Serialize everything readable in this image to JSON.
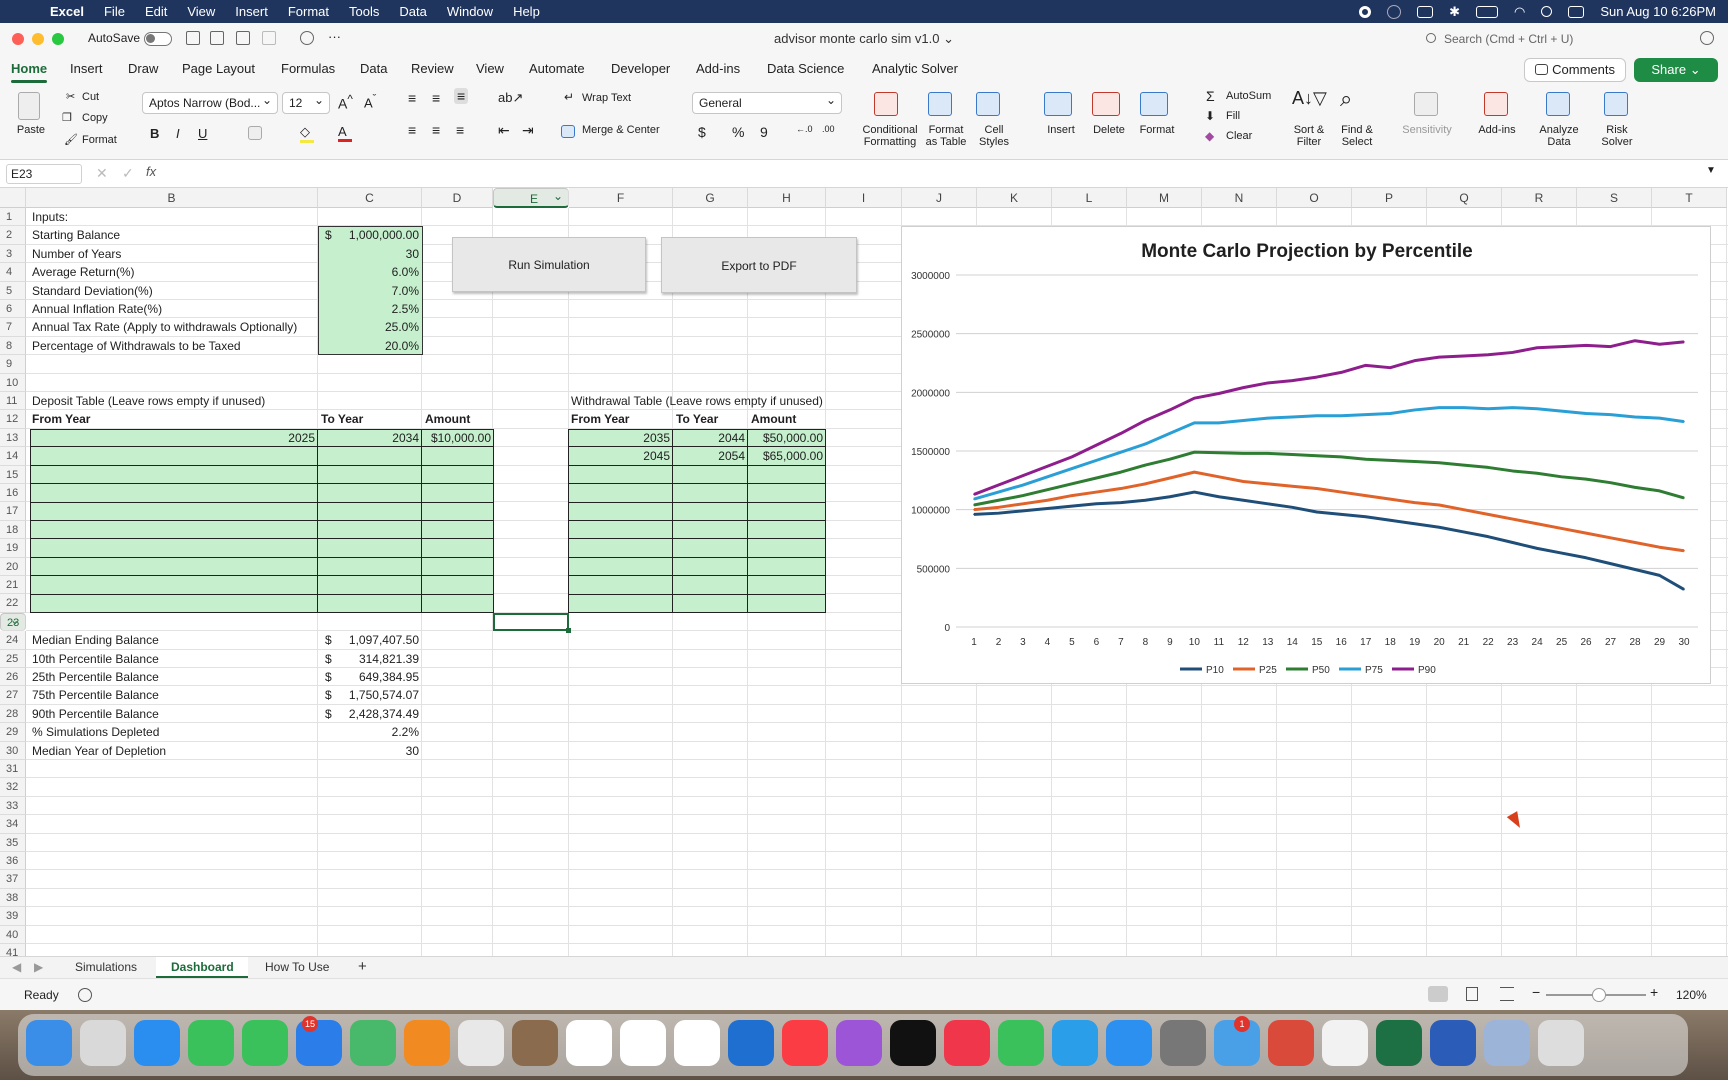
{
  "menubar": {
    "app": "Excel",
    "items": [
      "File",
      "Edit",
      "View",
      "Insert",
      "Format",
      "Tools",
      "Data",
      "Window",
      "Help"
    ],
    "clock": "Sun Aug 10  6:26PM"
  },
  "titlebar": {
    "autosave": "AutoSave",
    "doc_title": "advisor monte carlo sim v1.0",
    "search_placeholder": "Search (Cmd + Ctrl + U)"
  },
  "ribbon_tabs": [
    "Home",
    "Insert",
    "Draw",
    "Page Layout",
    "Formulas",
    "Data",
    "Review",
    "View",
    "Automate",
    "Developer",
    "Add-ins",
    "Data Science",
    "Analytic Solver"
  ],
  "comments": "Comments",
  "share": "Share",
  "ribbon": {
    "paste": "Paste",
    "cut": "Cut",
    "copy": "Copy",
    "format_painter": "Format",
    "font_name": "Aptos Narrow (Bod...",
    "font_size": "12",
    "bold": "B",
    "italic": "I",
    "underline": "U",
    "wrap_text": "Wrap Text",
    "merge_center": "Merge & Center",
    "number_format": "General",
    "dollar": "$",
    "percent": "%",
    "comma": "9",
    "conditional": "Conditional\nFormatting",
    "format_table": "Format\nas Table",
    "cell_styles": "Cell\nStyles",
    "insert": "Insert",
    "delete": "Delete",
    "format": "Format",
    "autosum": "AutoSum",
    "fill": "Fill",
    "clear": "Clear",
    "sort_filter": "Sort &\nFilter",
    "find_select": "Find &\nSelect",
    "sensitivity": "Sensitivity",
    "addins": "Add-ins",
    "analyze": "Analyze\nData",
    "risk_solver": "Risk\nSolver"
  },
  "formula_bar": {
    "name_box": "E23",
    "fx": "fx"
  },
  "columns": [
    "B",
    "C",
    "D",
    "E",
    "F",
    "G",
    "H",
    "I",
    "J",
    "K",
    "L",
    "M",
    "N",
    "O",
    "P",
    "Q",
    "R",
    "S",
    "T"
  ],
  "rows": [
    "1",
    "2",
    "3",
    "4",
    "5",
    "6",
    "7",
    "8",
    "9",
    "10",
    "11",
    "12",
    "13",
    "14",
    "15",
    "16",
    "17",
    "18",
    "19",
    "20",
    "21",
    "22",
    "23",
    "24",
    "25",
    "26",
    "27",
    "28",
    "29",
    "30",
    "31",
    "32",
    "33",
    "34",
    "35",
    "36",
    "37",
    "38",
    "39",
    "40",
    "41"
  ],
  "inputs": {
    "header": "Inputs:",
    "labels": [
      "Starting Balance",
      "Number of Years",
      "Average Return(%)",
      "Standard Deviation(%)",
      "Annual Inflation Rate(%)",
      "Annual Tax Rate (Apply to withdrawals Optionally)",
      "Percentage of Withdrawals to be Taxed"
    ],
    "dollar_sign": "$",
    "values": [
      "1,000,000.00",
      "30",
      "6.0%",
      "7.0%",
      "2.5%",
      "25.0%",
      "20.0%"
    ]
  },
  "buttons": {
    "run": "Run Simulation",
    "export": "Export to PDF"
  },
  "deposit": {
    "title": "Deposit Table (Leave rows empty if unused)",
    "headers": [
      "From Year",
      "To Year",
      "Amount"
    ],
    "row": [
      "2025",
      "2034",
      "$10,000.00"
    ]
  },
  "withdrawal": {
    "title": "Withdrawal Table (Leave rows empty if unused)",
    "headers": [
      "From Year",
      "To Year",
      "Amount"
    ],
    "rows": [
      [
        "2035",
        "2044",
        "$50,000.00"
      ],
      [
        "2045",
        "2054",
        "$65,000.00"
      ]
    ]
  },
  "results": {
    "labels": [
      "Median Ending Balance",
      "10th Percentile Balance",
      "25th Percentile Balance",
      "75th Percentile Balance",
      "90th Percentile Balance",
      "% Simulations Depleted",
      "Median Year of Depletion"
    ],
    "dollar_sign": "$",
    "values": [
      "1,097,407.50",
      "314,821.39",
      "649,384.95",
      "1,750,574.07",
      "2,428,374.49",
      "2.2%",
      "30"
    ]
  },
  "chart_data": {
    "type": "line",
    "title": "Monte Carlo Projection by Percentile",
    "x": [
      1,
      2,
      3,
      4,
      5,
      6,
      7,
      8,
      9,
      10,
      11,
      12,
      13,
      14,
      15,
      16,
      17,
      18,
      19,
      20,
      21,
      22,
      23,
      24,
      25,
      26,
      27,
      28,
      29,
      30
    ],
    "ylim": [
      0,
      3000000
    ],
    "yticks": [
      "0",
      "500000",
      "1000000",
      "1500000",
      "2000000",
      "2500000",
      "3000000"
    ],
    "grid": true,
    "legend": "bottom",
    "series": [
      {
        "name": "P10",
        "color": "#1f4e79",
        "values": [
          960000,
          970000,
          990000,
          1010000,
          1030000,
          1050000,
          1060000,
          1080000,
          1110000,
          1150000,
          1110000,
          1080000,
          1050000,
          1020000,
          980000,
          960000,
          940000,
          910000,
          880000,
          850000,
          810000,
          770000,
          720000,
          670000,
          630000,
          590000,
          540000,
          490000,
          440000,
          320000
        ]
      },
      {
        "name": "P25",
        "color": "#e0632a",
        "values": [
          1000000,
          1020000,
          1050000,
          1080000,
          1120000,
          1150000,
          1180000,
          1220000,
          1270000,
          1320000,
          1280000,
          1240000,
          1220000,
          1200000,
          1180000,
          1150000,
          1120000,
          1090000,
          1060000,
          1040000,
          1000000,
          960000,
          920000,
          880000,
          840000,
          800000,
          760000,
          720000,
          680000,
          650000
        ]
      },
      {
        "name": "P50",
        "color": "#2e7d32",
        "values": [
          1040000,
          1080000,
          1120000,
          1170000,
          1220000,
          1270000,
          1320000,
          1380000,
          1430000,
          1490000,
          1485000,
          1480000,
          1480000,
          1470000,
          1460000,
          1450000,
          1430000,
          1420000,
          1410000,
          1400000,
          1380000,
          1360000,
          1330000,
          1310000,
          1280000,
          1260000,
          1230000,
          1190000,
          1160000,
          1100000
        ]
      },
      {
        "name": "P75",
        "color": "#2a9fd6",
        "values": [
          1090000,
          1150000,
          1210000,
          1280000,
          1350000,
          1420000,
          1490000,
          1560000,
          1650000,
          1740000,
          1740000,
          1760000,
          1780000,
          1790000,
          1800000,
          1800000,
          1810000,
          1820000,
          1850000,
          1870000,
          1870000,
          1860000,
          1870000,
          1860000,
          1840000,
          1820000,
          1810000,
          1790000,
          1780000,
          1750000
        ]
      },
      {
        "name": "P90",
        "color": "#8e1e8c",
        "values": [
          1130000,
          1210000,
          1290000,
          1370000,
          1450000,
          1550000,
          1650000,
          1760000,
          1850000,
          1950000,
          1990000,
          2040000,
          2080000,
          2100000,
          2130000,
          2170000,
          2230000,
          2210000,
          2270000,
          2300000,
          2310000,
          2320000,
          2340000,
          2380000,
          2390000,
          2400000,
          2390000,
          2440000,
          2410000,
          2430000
        ]
      }
    ]
  },
  "sheet_tabs": [
    "Simulations",
    "Dashboard",
    "How To Use"
  ],
  "status": {
    "ready": "Ready",
    "zoom": "120%"
  }
}
